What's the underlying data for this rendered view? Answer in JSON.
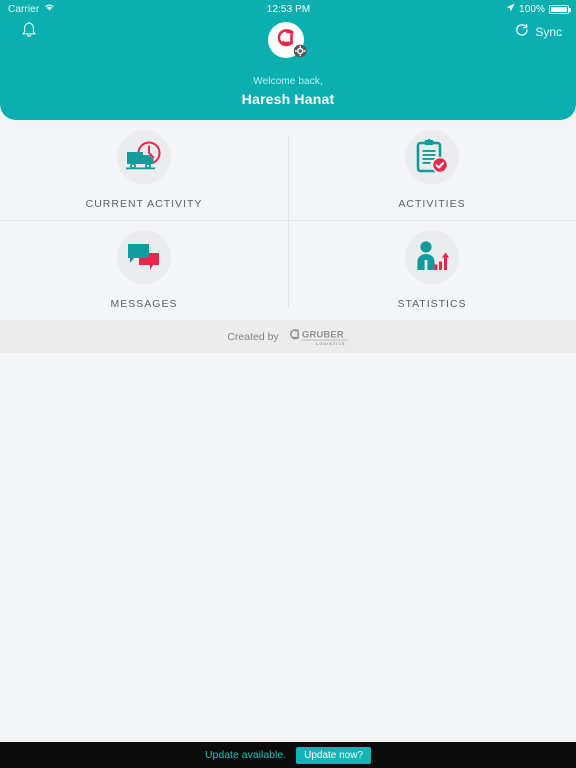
{
  "status_bar": {
    "carrier": "Carrier",
    "wifi_icon": "wifi-icon",
    "time": "12:53 PM",
    "location_icon": "location-arrow-icon",
    "battery_percent": "100%",
    "battery_icon": "battery-full-icon"
  },
  "header": {
    "bell_icon": "bell-icon",
    "app_logo_icon": "gruber-app-logo-icon",
    "sync_icon": "refresh-icon",
    "sync_label": "Sync",
    "welcome_prefix": "Welcome back,",
    "user_name": "Haresh Hanat",
    "background_color": "#0CAFAF"
  },
  "tiles": [
    {
      "id": "current-activity",
      "label": "CURRENT ACTIVITY",
      "icon": "truck-clock-icon"
    },
    {
      "id": "activities",
      "label": "ACTIVITIES",
      "icon": "clipboard-check-icon"
    },
    {
      "id": "messages",
      "label": "MESSAGES",
      "icon": "chat-bubbles-icon"
    },
    {
      "id": "statistics",
      "label": "STATISTICS",
      "icon": "person-bar-chart-icon"
    }
  ],
  "created_by": {
    "text": "Created by",
    "brand_name": "GRUBER",
    "brand_sub": "LOGISTICS",
    "brand_mark_icon": "gruber-mark-icon"
  },
  "update_bar": {
    "message": "Update available.",
    "button_label": "Update now?",
    "accent_color": "#12b5b5"
  },
  "colors": {
    "teal": "#0CAFAF",
    "red": "#E8274B",
    "icon_teal": "#129B9B",
    "page_background": "#f4f5f7",
    "footer_band": "#ececec",
    "update_bar_bg": "#0b0b0b"
  }
}
